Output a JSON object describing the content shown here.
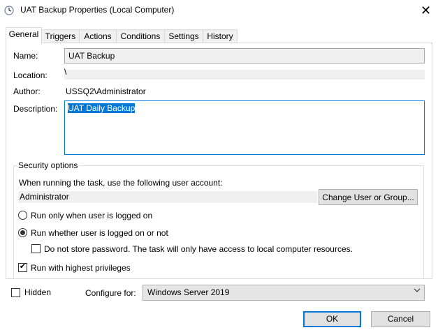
{
  "window": {
    "title": "UAT Backup Properties (Local Computer)",
    "icon": "task-scheduler-clock-icon",
    "close_glyph": "✕"
  },
  "tabs": [
    {
      "label": "General",
      "active": true
    },
    {
      "label": "Triggers",
      "active": false
    },
    {
      "label": "Actions",
      "active": false
    },
    {
      "label": "Conditions",
      "active": false
    },
    {
      "label": "Settings",
      "active": false
    },
    {
      "label": "History",
      "active": false
    }
  ],
  "general": {
    "name_label": "Name:",
    "name_value": "UAT Backup",
    "location_label": "Location:",
    "location_value": "\\",
    "author_label": "Author:",
    "author_value": "USSQ2\\Administrator",
    "description_label": "Description:",
    "description_value": "UAT Daily Backup"
  },
  "security": {
    "legend": "Security options",
    "account_prompt": "When running the task, use the following user account:",
    "account_value": "Administrator",
    "change_button": "Change User or Group...",
    "radio_logged_on": "Run only when user is logged on",
    "radio_logged_on_selected": false,
    "radio_whether": "Run whether user is logged on or not",
    "radio_whether_selected": true,
    "no_store_password": "Do not store password.  The task will only have access to local computer resources.",
    "no_store_password_checked": false,
    "highest_privileges": "Run with highest privileges",
    "highest_privileges_checked": true
  },
  "footer": {
    "hidden_label": "Hidden",
    "hidden_checked": false,
    "configure_label": "Configure for:",
    "configure_value": "Windows Server 2019",
    "ok_label": "OK",
    "cancel_label": "Cancel"
  },
  "colors": {
    "accent": "#0078d7",
    "button_face": "#e1e1e1",
    "readonly_bg": "#f0f0f0"
  }
}
